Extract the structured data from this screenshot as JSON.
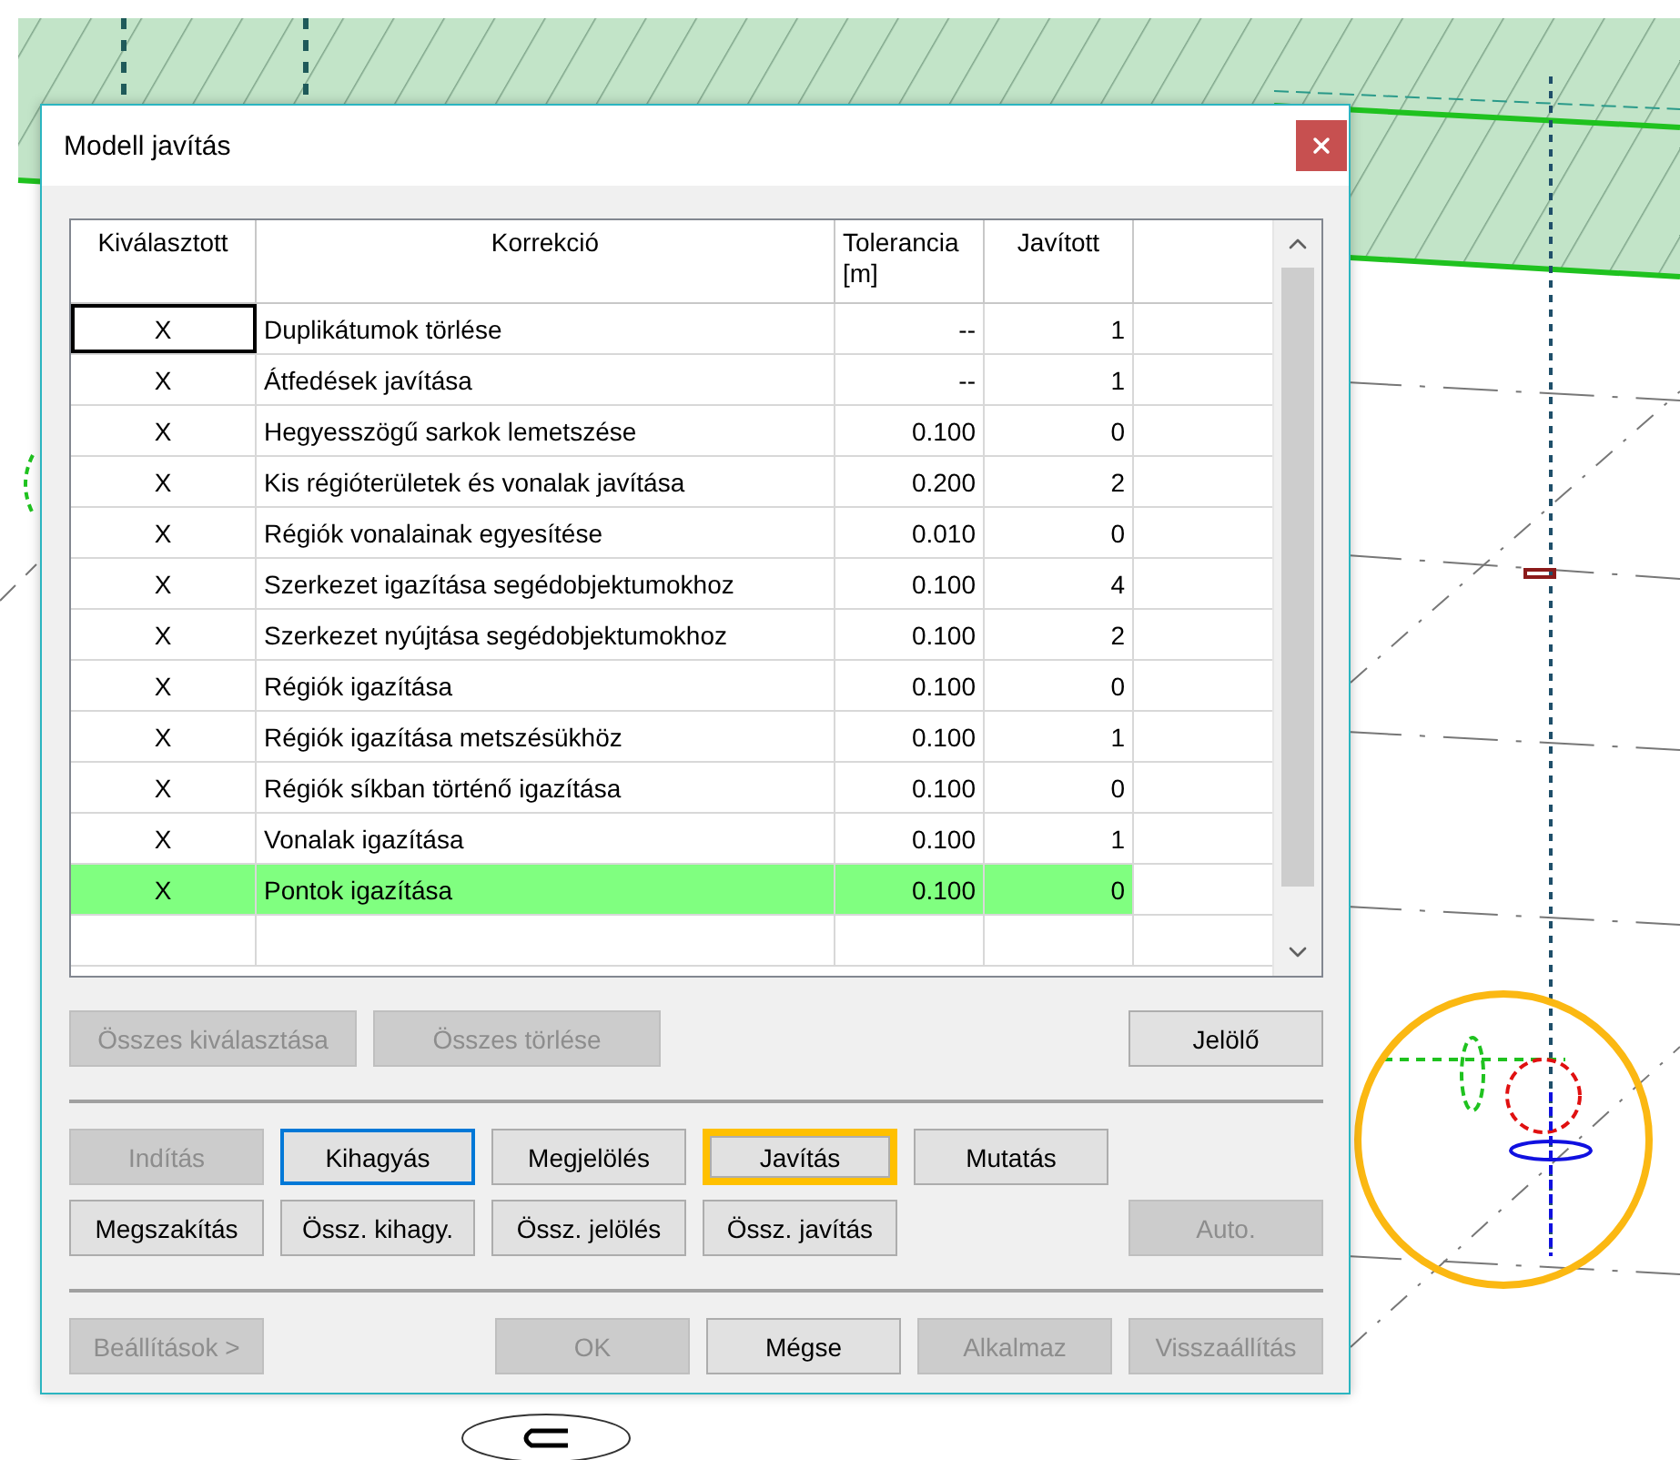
{
  "dialog": {
    "title": "Modell javítás"
  },
  "table": {
    "columns": [
      "Kiválasztott",
      "Korrekció",
      "Tolerancia [m]",
      "Javított"
    ],
    "rows": [
      {
        "mark": "X",
        "name": "Duplikátumok törlése",
        "tolerance": "--",
        "fixed": "1",
        "selected": false,
        "focused": true
      },
      {
        "mark": "X",
        "name": "Átfedések javítása",
        "tolerance": "--",
        "fixed": "1",
        "selected": false,
        "focused": false
      },
      {
        "mark": "X",
        "name": "Hegyesszögű sarkok lemetszése",
        "tolerance": "0.100",
        "fixed": "0",
        "selected": false,
        "focused": false
      },
      {
        "mark": "X",
        "name": "Kis régióterületek és vonalak javítása",
        "tolerance": "0.200",
        "fixed": "2",
        "selected": false,
        "focused": false
      },
      {
        "mark": "X",
        "name": "Régiók vonalainak egyesítése",
        "tolerance": "0.010",
        "fixed": "0",
        "selected": false,
        "focused": false
      },
      {
        "mark": "X",
        "name": "Szerkezet igazítása segédobjektumokhoz",
        "tolerance": "0.100",
        "fixed": "4",
        "selected": false,
        "focused": false
      },
      {
        "mark": "X",
        "name": "Szerkezet nyújtása segédobjektumokhoz",
        "tolerance": "0.100",
        "fixed": "2",
        "selected": false,
        "focused": false
      },
      {
        "mark": "X",
        "name": "Régiók igazítása",
        "tolerance": "0.100",
        "fixed": "0",
        "selected": false,
        "focused": false
      },
      {
        "mark": "X",
        "name": "Régiók igazítása metszésükhöz",
        "tolerance": "0.100",
        "fixed": "1",
        "selected": false,
        "focused": false
      },
      {
        "mark": "X",
        "name": "Régiók síkban történő igazítása",
        "tolerance": "0.100",
        "fixed": "0",
        "selected": false,
        "focused": false
      },
      {
        "mark": "X",
        "name": "Vonalak igazítása",
        "tolerance": "0.100",
        "fixed": "1",
        "selected": false,
        "focused": false
      },
      {
        "mark": "X",
        "name": "Pontok igazítása",
        "tolerance": "0.100",
        "fixed": "0",
        "selected": true,
        "focused": false
      }
    ]
  },
  "button_rows": [
    {
      "left": [
        {
          "label": "Összes kiválasztása",
          "disabled": true,
          "focused": false,
          "highlighted": false
        },
        {
          "label": "Összes törlése",
          "disabled": true,
          "focused": false,
          "highlighted": false
        }
      ],
      "right": [
        {
          "label": "Jelölő",
          "disabled": false,
          "focused": false,
          "highlighted": false
        }
      ]
    },
    {
      "left": [
        {
          "label": "Indítás",
          "disabled": true,
          "focused": false,
          "highlighted": false
        },
        {
          "label": "Kihagyás",
          "disabled": false,
          "focused": true,
          "highlighted": false
        },
        {
          "label": "Megjelölés",
          "disabled": false,
          "focused": false,
          "highlighted": false
        },
        {
          "label": "Javítás",
          "disabled": false,
          "focused": false,
          "highlighted": true
        },
        {
          "label": "Mutatás",
          "disabled": false,
          "focused": false,
          "highlighted": false
        }
      ],
      "right": []
    },
    {
      "left": [
        {
          "label": "Megszakítás",
          "disabled": false,
          "focused": false,
          "highlighted": false
        },
        {
          "label": "Össz. kihagy.",
          "disabled": false,
          "focused": false,
          "highlighted": false
        },
        {
          "label": "Össz. jelölés",
          "disabled": false,
          "focused": false,
          "highlighted": false
        },
        {
          "label": "Össz. javítás",
          "disabled": false,
          "focused": false,
          "highlighted": false
        }
      ],
      "right": [
        {
          "label": "Auto.",
          "disabled": true,
          "focused": false,
          "highlighted": false
        }
      ]
    },
    {
      "left": [
        {
          "label": "Beállítások >",
          "disabled": true,
          "focused": false,
          "highlighted": false
        }
      ],
      "right": [
        {
          "label": "OK",
          "disabled": true,
          "focused": false,
          "highlighted": false
        },
        {
          "label": "Mégse",
          "disabled": false,
          "focused": false,
          "highlighted": false
        },
        {
          "label": "Alkalmaz",
          "disabled": true,
          "focused": false,
          "highlighted": false
        },
        {
          "label": "Visszaállítás",
          "disabled": true,
          "focused": false,
          "highlighted": false
        }
      ]
    }
  ]
}
